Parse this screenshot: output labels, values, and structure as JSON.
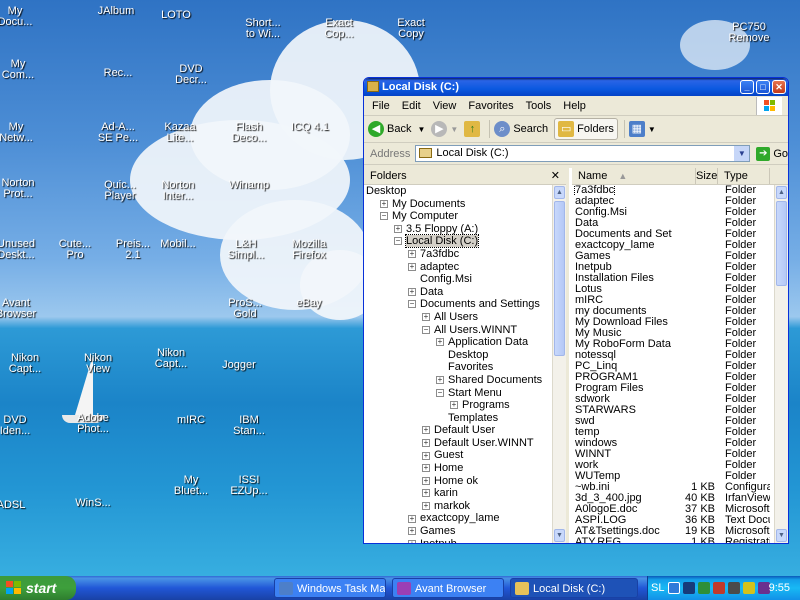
{
  "desktop": {
    "icons": [
      {
        "label": "My\nDocu..."
      },
      {
        "label": "JAlbum"
      },
      {
        "label": "LOTO"
      },
      {
        "label": "Short...\nto Wi..."
      },
      {
        "label": "Exact\nCop..."
      },
      {
        "label": "Exact\nCopy"
      },
      {
        "label": "PC750\nRemove"
      },
      {
        "label": "My\nCom..."
      },
      {
        "label": "Rec..."
      },
      {
        "label": "DVD\nDecr..."
      },
      {
        "label": "My\nNetw..."
      },
      {
        "label": "Ad-A...\nSE Pe..."
      },
      {
        "label": "Kazaa\nLite..."
      },
      {
        "label": "Flash\nDeco..."
      },
      {
        "label": "ICQ 4.1"
      },
      {
        "label": "Norton\nProt..."
      },
      {
        "label": "Quic...\nPlayer"
      },
      {
        "label": "Norton\nInter..."
      },
      {
        "label": "Winamp"
      },
      {
        "label": "Unused\nDeskt..."
      },
      {
        "label": "Cute...\nPro"
      },
      {
        "label": "Preis...\n2.1"
      },
      {
        "label": "Mobil..."
      },
      {
        "label": "L&H\nSimpl..."
      },
      {
        "label": "Mozilla\nFirefox"
      },
      {
        "label": "Avant\nBrowser"
      },
      {
        "label": "ProS...\nGold"
      },
      {
        "label": "eBay"
      },
      {
        "label": "Nikon\nCapt..."
      },
      {
        "label": "Nikon\nView"
      },
      {
        "label": "Nikon\nCapt..."
      },
      {
        "label": "Jogger"
      },
      {
        "label": "DVD\nIden..."
      },
      {
        "label": "Adobe\nPhot..."
      },
      {
        "label": "mIRC"
      },
      {
        "label": "IBM\nStan..."
      },
      {
        "label": "My\nBluet..."
      },
      {
        "label": "ISSI\nEZUp..."
      },
      {
        "label": "ADSL"
      },
      {
        "label": "WinS..."
      }
    ]
  },
  "window": {
    "title": "Local Disk (C:)",
    "menu": [
      "File",
      "Edit",
      "View",
      "Favorites",
      "Tools",
      "Help"
    ],
    "toolbar": {
      "back": "Back",
      "search": "Search",
      "folders": "Folders"
    },
    "address": {
      "label": "Address",
      "value": "Local Disk (C:)",
      "go": "Go"
    },
    "folders_pane": {
      "title": "Folders",
      "close": "✕",
      "tree": [
        {
          "label": "Desktop",
          "level": 0,
          "toggle": ""
        },
        {
          "label": "My Documents",
          "level": 1,
          "toggle": "+"
        },
        {
          "label": "My Computer",
          "level": 1,
          "toggle": "−"
        },
        {
          "label": "3.5 Floppy (A:)",
          "level": 2,
          "toggle": "+"
        },
        {
          "label": "Local Disk (C:)",
          "level": 2,
          "toggle": "−",
          "selected": true
        },
        {
          "label": "7a3fdbc",
          "level": 3,
          "toggle": "+"
        },
        {
          "label": "adaptec",
          "level": 3,
          "toggle": "+"
        },
        {
          "label": "Config.Msi",
          "level": 3,
          "toggle": ""
        },
        {
          "label": "Data",
          "level": 3,
          "toggle": "+"
        },
        {
          "label": "Documents and Settings",
          "level": 3,
          "toggle": "−"
        },
        {
          "label": "All Users",
          "level": 4,
          "toggle": "+"
        },
        {
          "label": "All Users.WINNT",
          "level": 4,
          "toggle": "−"
        },
        {
          "label": "Application Data",
          "level": 5,
          "toggle": "+"
        },
        {
          "label": "Desktop",
          "level": 5,
          "toggle": ""
        },
        {
          "label": "Favorites",
          "level": 5,
          "toggle": ""
        },
        {
          "label": "Shared Documents",
          "level": 5,
          "toggle": "+"
        },
        {
          "label": "Start Menu",
          "level": 5,
          "toggle": "−"
        },
        {
          "label": "Programs",
          "level": 6,
          "toggle": "+"
        },
        {
          "label": "Templates",
          "level": 5,
          "toggle": ""
        },
        {
          "label": "Default User",
          "level": 4,
          "toggle": "+"
        },
        {
          "label": "Default User.WINNT",
          "level": 4,
          "toggle": "+"
        },
        {
          "label": "Guest",
          "level": 4,
          "toggle": "+"
        },
        {
          "label": "Home",
          "level": 4,
          "toggle": "+"
        },
        {
          "label": "Home ok",
          "level": 4,
          "toggle": "+"
        },
        {
          "label": "karin",
          "level": 4,
          "toggle": "+"
        },
        {
          "label": "markok",
          "level": 4,
          "toggle": "+"
        },
        {
          "label": "exactcopy_lame",
          "level": 3,
          "toggle": "+"
        },
        {
          "label": "Games",
          "level": 3,
          "toggle": "+"
        },
        {
          "label": "Inetpub",
          "level": 3,
          "toggle": "+"
        }
      ]
    },
    "files": {
      "columns": {
        "name": "Name",
        "size": "Size",
        "type": "Type"
      },
      "rows": [
        {
          "name": "7a3fdbc",
          "size": "",
          "type": "Folder"
        },
        {
          "name": "adaptec",
          "size": "",
          "type": "Folder"
        },
        {
          "name": "Config.Msi",
          "size": "",
          "type": "Folder"
        },
        {
          "name": "Data",
          "size": "",
          "type": "Folder"
        },
        {
          "name": "Documents and Settings",
          "size": "",
          "type": "Folder"
        },
        {
          "name": "exactcopy_lame",
          "size": "",
          "type": "Folder"
        },
        {
          "name": "Games",
          "size": "",
          "type": "Folder"
        },
        {
          "name": "Inetpub",
          "size": "",
          "type": "Folder"
        },
        {
          "name": "Installation Files",
          "size": "",
          "type": "Folder"
        },
        {
          "name": "Lotus",
          "size": "",
          "type": "Folder"
        },
        {
          "name": "mIRC",
          "size": "",
          "type": "Folder"
        },
        {
          "name": "my documents",
          "size": "",
          "type": "Folder"
        },
        {
          "name": "My Download Files",
          "size": "",
          "type": "Folder"
        },
        {
          "name": "My Music",
          "size": "",
          "type": "Folder"
        },
        {
          "name": "My RoboForm Data",
          "size": "",
          "type": "Folder"
        },
        {
          "name": "notessql",
          "size": "",
          "type": "Folder"
        },
        {
          "name": "PC_Linq",
          "size": "",
          "type": "Folder"
        },
        {
          "name": "PROGRAM1",
          "size": "",
          "type": "Folder"
        },
        {
          "name": "Program Files",
          "size": "",
          "type": "Folder"
        },
        {
          "name": "sdwork",
          "size": "",
          "type": "Folder"
        },
        {
          "name": "STARWARS",
          "size": "",
          "type": "Folder"
        },
        {
          "name": "swd",
          "size": "",
          "type": "Folder"
        },
        {
          "name": "temp",
          "size": "",
          "type": "Folder"
        },
        {
          "name": "windows",
          "size": "",
          "type": "Folder"
        },
        {
          "name": "WINNT",
          "size": "",
          "type": "Folder"
        },
        {
          "name": "work",
          "size": "",
          "type": "Folder"
        },
        {
          "name": "WUTemp",
          "size": "",
          "type": "Folder"
        },
        {
          "name": "~wb.ini",
          "size": "1 KB",
          "type": "Configuratio"
        },
        {
          "name": "3d_3_400.jpg",
          "size": "40 KB",
          "type": "IrfanView JF"
        },
        {
          "name": "A0logoE.doc",
          "size": "37 KB",
          "type": "Microsoft W"
        },
        {
          "name": "ASPI.LOG",
          "size": "36 KB",
          "type": "Text Docume"
        },
        {
          "name": "AT&Tsettings.doc",
          "size": "19 KB",
          "type": "Microsoft W"
        },
        {
          "name": "ATY.REG",
          "size": "1 KB",
          "type": "Registration"
        }
      ]
    }
  },
  "taskbar": {
    "start": "start",
    "buttons": [
      {
        "label": "Windows Task Mana...",
        "color": "#4d7fc9"
      },
      {
        "label": "Avant Browser",
        "color": "#9b3fb4"
      },
      {
        "label": "Local Disk (C:)",
        "color": "#e6c15a"
      }
    ],
    "tray": {
      "lang": "SL",
      "time": "9:55"
    }
  }
}
